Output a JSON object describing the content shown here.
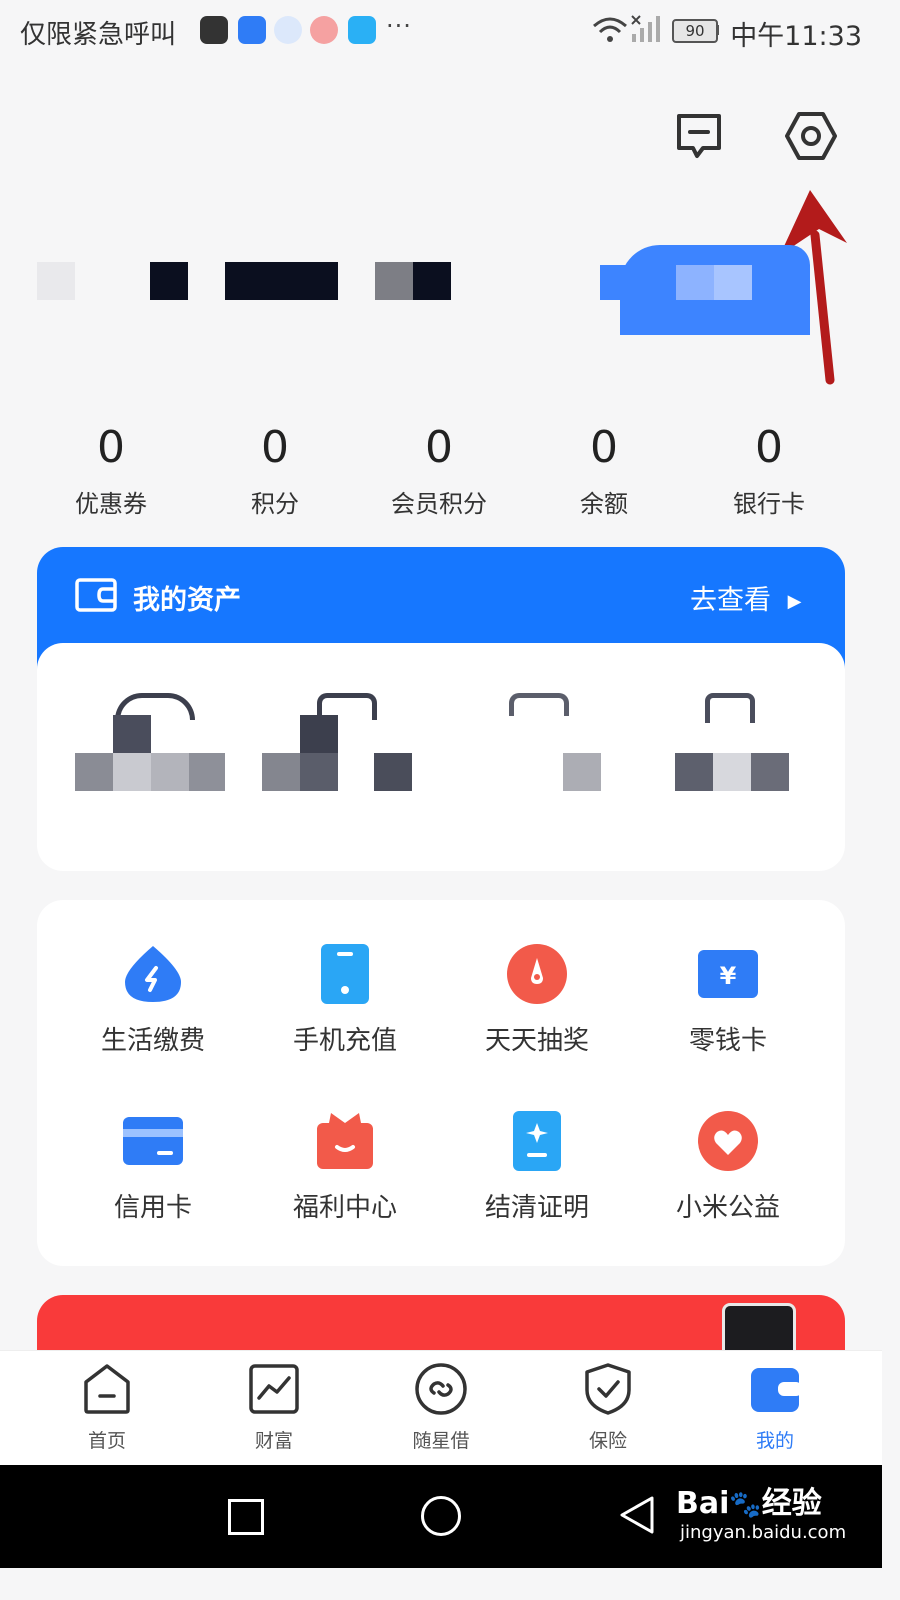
{
  "status_bar": {
    "left_text": "仅限紧急呼叫",
    "more": "···",
    "battery": "90",
    "time": "中午11:33",
    "icons": [
      "huawei-app-icon",
      "bulb-app-icon",
      "network-app-icon",
      "wallet-app-icon",
      "browser-app-icon",
      "wifi-icon",
      "no-signal-icon"
    ]
  },
  "header": {
    "icons": [
      "message-icon",
      "settings-icon"
    ]
  },
  "stats": [
    {
      "value": "0",
      "label": "优惠券"
    },
    {
      "value": "0",
      "label": "积分"
    },
    {
      "value": "0",
      "label": "会员积分"
    },
    {
      "value": "0",
      "label": "余额"
    },
    {
      "value": "0",
      "label": "银行卡"
    }
  ],
  "assets": {
    "title": "我的资产",
    "link": "去查看",
    "link_arrow": "▶"
  },
  "services": [
    {
      "label": "生活缴费",
      "icon": "water-drop-icon",
      "color": "#2f7cf6"
    },
    {
      "label": "手机充值",
      "icon": "phone-icon",
      "color": "#2aa6f5"
    },
    {
      "label": "天天抽奖",
      "icon": "lottery-icon",
      "color": "#f25a4a"
    },
    {
      "label": "零钱卡",
      "icon": "yuan-card-icon",
      "color": "#2f7cf6"
    },
    {
      "label": "信用卡",
      "icon": "credit-card-icon",
      "color": "#2f7cf6"
    },
    {
      "label": "福利中心",
      "icon": "gift-icon",
      "color": "#f25a4a"
    },
    {
      "label": "结清证明",
      "icon": "certificate-icon",
      "color": "#2aa6f5"
    },
    {
      "label": "小米公益",
      "icon": "heart-icon",
      "color": "#f25a4a"
    }
  ],
  "tabs": [
    {
      "label": "首页",
      "icon": "home-icon",
      "active": false
    },
    {
      "label": "财富",
      "icon": "chart-icon",
      "active": false
    },
    {
      "label": "随星借",
      "icon": "loan-icon",
      "active": false
    },
    {
      "label": "保险",
      "icon": "shield-icon",
      "active": false
    },
    {
      "label": "我的",
      "icon": "wallet-icon",
      "active": true
    }
  ],
  "colors": {
    "primary": "#1677ff",
    "active_tab": "#2f7cf6",
    "promo": "#f93a3a",
    "annotation_arrow": "#b31b1b"
  },
  "watermark": {
    "brand": "Bai",
    "paw": "🐾",
    "brand2": "经验",
    "url": "jingyan.baidu.com"
  }
}
